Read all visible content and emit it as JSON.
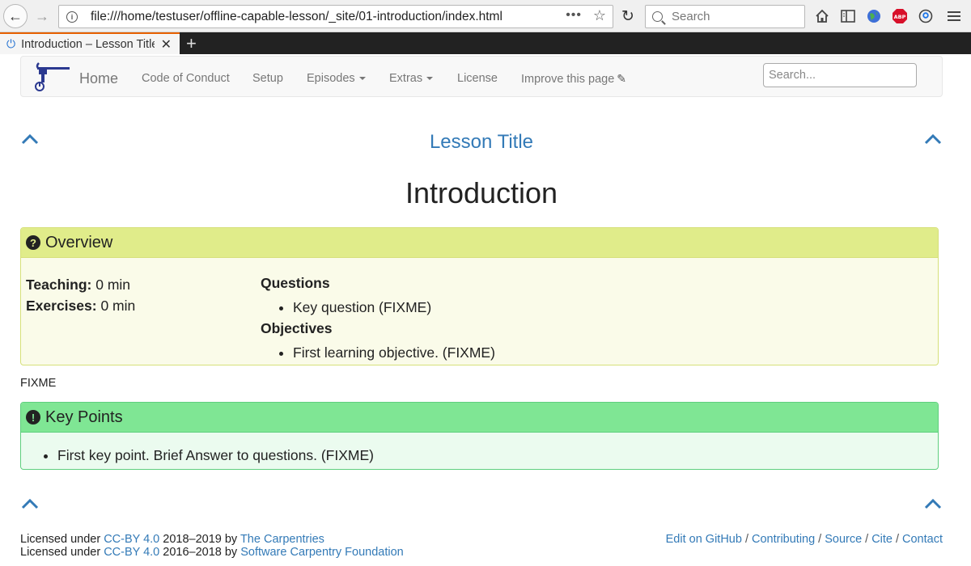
{
  "browser": {
    "url": "file:///home/testuser/offline-capable-lesson/_site/01-introduction/index.html",
    "search_placeholder": "Search",
    "tab_title": "Introduction – Lesson Title",
    "url_more_icon": "page-actions-icon",
    "bookmark_icon": "star-icon"
  },
  "navbar": {
    "home": "Home",
    "items": [
      "Code of Conduct",
      "Setup",
      "Episodes",
      "Extras",
      "License",
      "Improve this page"
    ],
    "search_placeholder": "Search..."
  },
  "page": {
    "lesson_title": "Lesson Title",
    "title": "Introduction"
  },
  "overview": {
    "heading": "Overview",
    "teaching_label": "Teaching:",
    "teaching_value": "0 min",
    "exercises_label": "Exercises:",
    "exercises_value": "0 min",
    "questions_label": "Questions",
    "questions": [
      "Key question (FIXME)"
    ],
    "objectives_label": "Objectives",
    "objectives": [
      "First learning objective. (FIXME)"
    ]
  },
  "body_text": "FIXME",
  "keypoints": {
    "heading": "Key Points",
    "items": [
      "First key point. Brief Answer to questions. (FIXME)"
    ]
  },
  "footer": {
    "line1_prefix": "Licensed under ",
    "line1_license": "CC-BY 4.0",
    "line1_middle": " 2018–2019 by ",
    "line1_org": "The Carpentries",
    "line2_prefix": "Licensed under ",
    "line2_license": "CC-BY 4.0",
    "line2_middle": " 2016–2018 by ",
    "line2_org": "Software Carpentry Foundation",
    "links": [
      "Edit on GitHub",
      "Contributing",
      "Source",
      "Cite",
      "Contact"
    ],
    "separator": "/"
  },
  "colors": {
    "link": "#337ab7",
    "overview_head": "#e0ec8a",
    "keypoints_head": "#7fe694",
    "tab_accent": "#e66000"
  }
}
